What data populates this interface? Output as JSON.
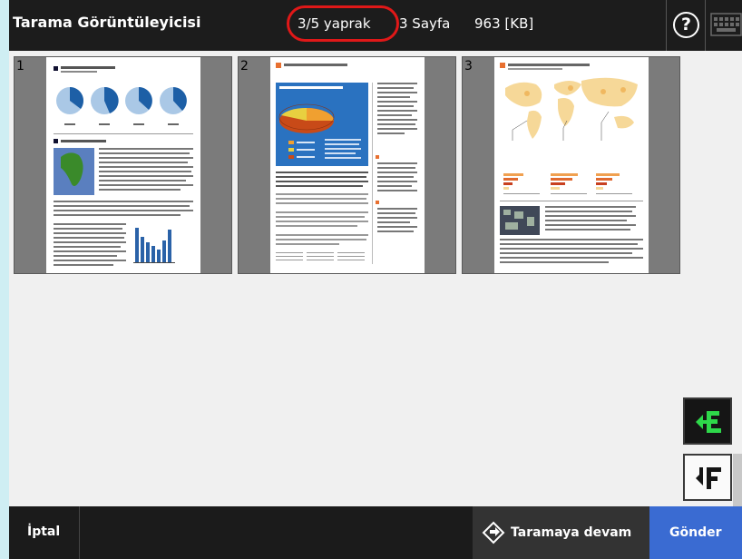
{
  "header": {
    "title": "Tarama Görüntüleyicisi",
    "sheet_count": "3/5 yaprak",
    "page_count": "3 Sayfa",
    "file_size": "963 [KB]",
    "help_icon": "question-mark-icon",
    "keyboard_icon": "keyboard-icon"
  },
  "thumbnails": [
    {
      "number": "1"
    },
    {
      "number": "2"
    },
    {
      "number": "3"
    }
  ],
  "side_buttons": {
    "sort_ascending_icon": "sort-ascending-icon",
    "sort_descending_icon": "sort-descending-icon"
  },
  "footer": {
    "cancel_label": "İptal",
    "continue_label": "Taramaya devam",
    "continue_icon": "scan-diamond-icon",
    "send_label": "Gönder"
  },
  "colors": {
    "header_bg": "#1c1c1c",
    "highlight_ring": "#e01818",
    "send_button": "#3a6bd2",
    "sort_ascending_accent": "#2ed84a"
  }
}
